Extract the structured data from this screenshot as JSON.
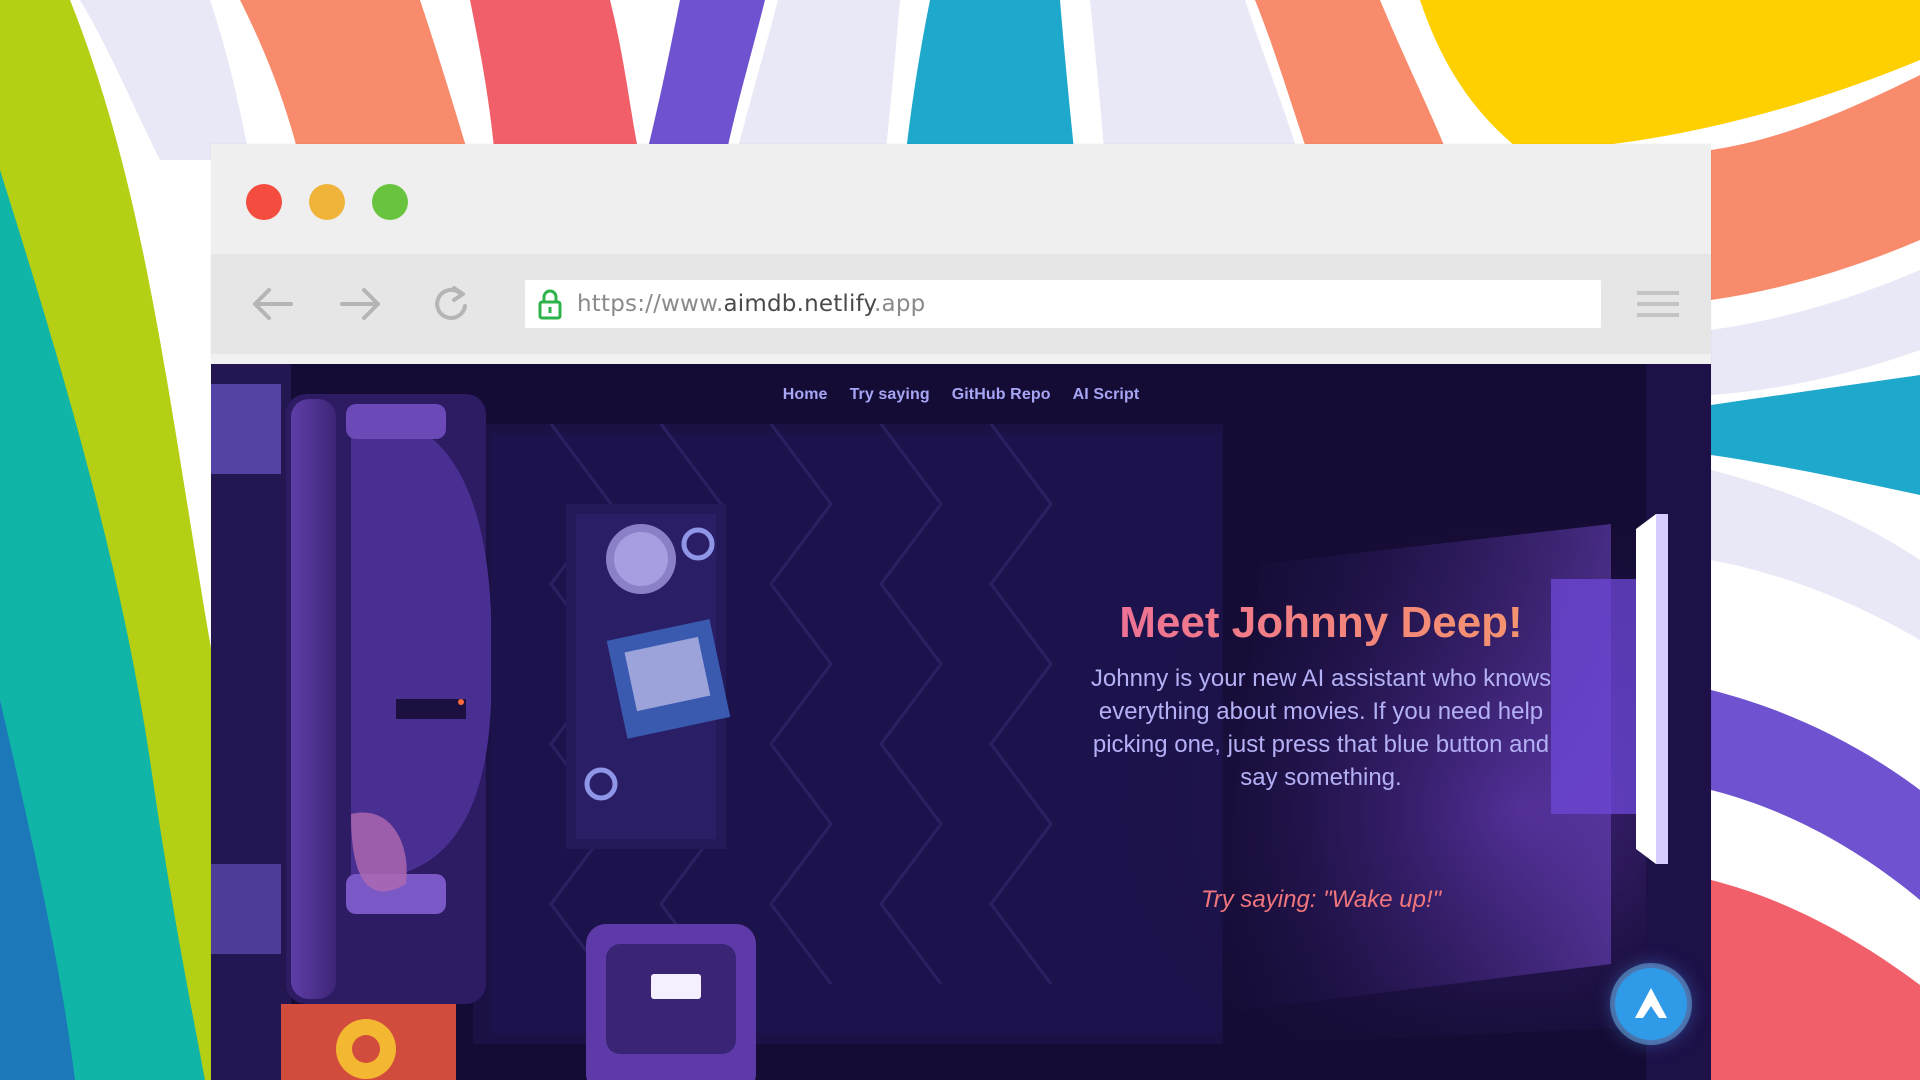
{
  "background": {
    "stripe_colors": [
      "#b5cf14",
      "#10b5a8",
      "#1c78b8",
      "#f78b6c",
      "#f05f6a",
      "#6e52cf",
      "#1ea8cc",
      "#ffd000",
      "#e8e8f6"
    ]
  },
  "browser": {
    "window_controls": {
      "close_color": "#f44c3f",
      "minimize_color": "#f0b43b",
      "maximize_color": "#68c43e"
    },
    "toolbar": {
      "back_icon": "arrow-left-icon",
      "forward_icon": "arrow-right-icon",
      "reload_icon": "reload-icon",
      "menu_icon": "hamburger-menu-icon"
    },
    "address_bar": {
      "lock_icon": "lock-icon",
      "url_prefix": "https://www.",
      "url_host": "aimdb.netlify",
      "url_suffix": ".app"
    }
  },
  "page": {
    "nav": {
      "items": [
        {
          "label": "Home"
        },
        {
          "label": "Try saying"
        },
        {
          "label": "GitHub Repo"
        },
        {
          "label": "AI Script"
        }
      ]
    },
    "hero": {
      "title": "Meet Johnny Deep!",
      "description": "Johnny is your new AI assistant who knows everything about movies. If you need help picking one, just press that blue button and say something."
    },
    "try_saying": "Try saying: \"Wake up!\"",
    "assistant_button": {
      "icon": "alan-ai-logo-icon",
      "color": "#2f9be8"
    },
    "accent_colors": {
      "nav_text": "#a6a6f5",
      "title_gradient_start": "#ec6c9d",
      "title_gradient_end": "#f59a6a",
      "body_text": "#b4b0f6",
      "try_text": "#f0757c"
    }
  }
}
